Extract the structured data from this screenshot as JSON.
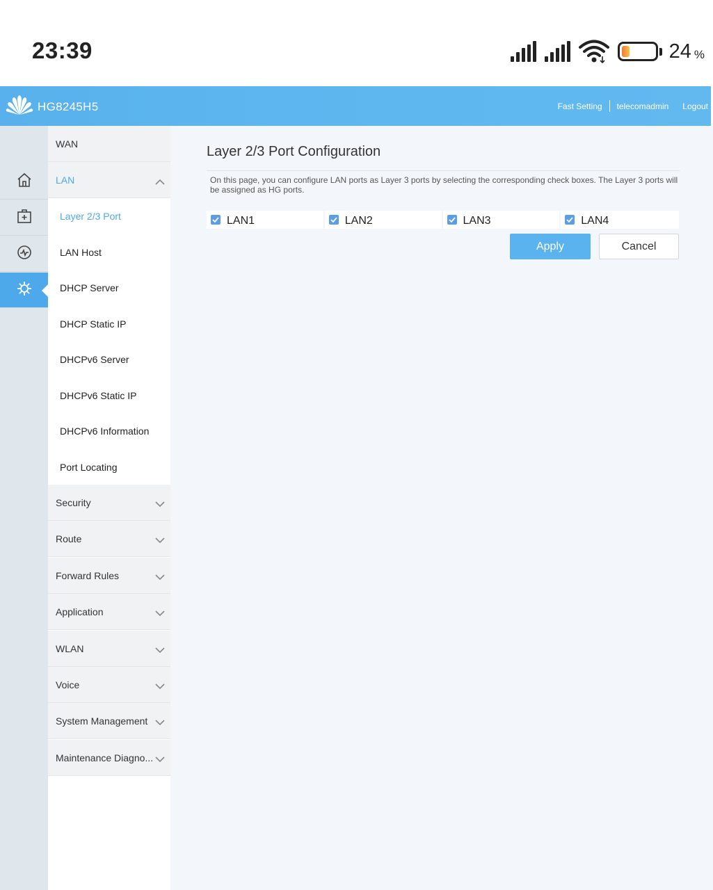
{
  "status_bar": {
    "time": "23:39",
    "battery_level": "24",
    "battery_unit": "%",
    "battery_fraction": 0.24,
    "icons": [
      "cellular-signal-icon",
      "cellular-signal-icon",
      "wifi-icon",
      "battery-icon"
    ]
  },
  "header": {
    "device_name": "HG8245H5",
    "fast_setting": "Fast Setting",
    "user": "telecomadmin",
    "logout": "Logout"
  },
  "rail": {
    "icons": [
      "home-icon",
      "toolbox-icon",
      "diagnose-icon",
      "settings-gear-icon"
    ],
    "active": "settings-gear-icon",
    "accent_color": "#4ea9ea"
  },
  "menu": {
    "wan": "WAN",
    "lan": "LAN",
    "lan_sub": [
      "Layer 2/3 Port",
      "LAN Host",
      "DHCP Server",
      "DHCP Static IP",
      "DHCPv6 Server",
      "DHCPv6 Static IP",
      "DHCPv6 Information",
      "Port Locating"
    ],
    "groups": [
      "Security",
      "Route",
      "Forward Rules",
      "Application",
      "WLAN",
      "Voice",
      "System Management",
      "Maintenance Diagno..."
    ]
  },
  "content": {
    "title": "Layer 2/3 Port Configuration",
    "description": "On this page, you can configure LAN ports as Layer 3 ports by selecting the corresponding check boxes. The Layer 3 ports will be assigned as HG ports.",
    "ports": [
      {
        "label": "LAN1",
        "checked": true
      },
      {
        "label": "LAN2",
        "checked": true
      },
      {
        "label": "LAN3",
        "checked": true
      },
      {
        "label": "LAN4",
        "checked": true
      }
    ],
    "apply": "Apply",
    "cancel": "Cancel"
  }
}
